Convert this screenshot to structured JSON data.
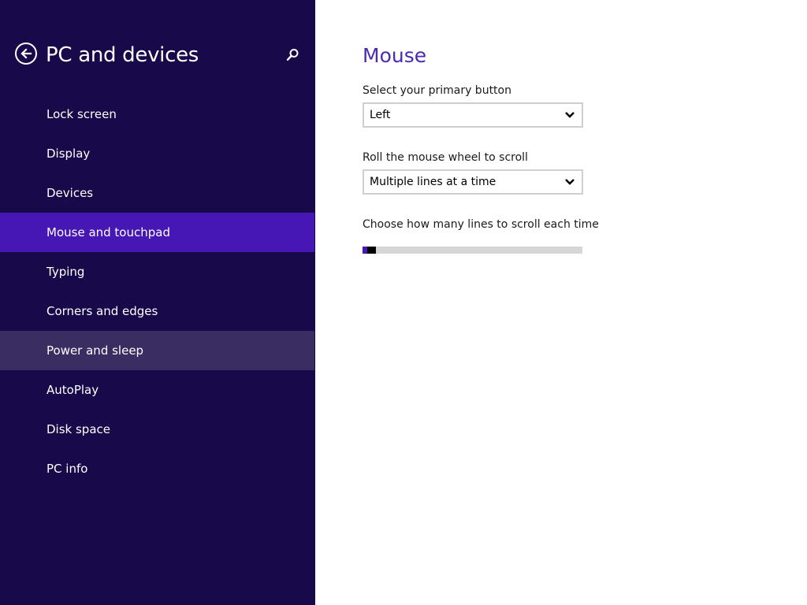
{
  "sidebar": {
    "title": "PC and devices",
    "back_icon": "back-arrow-icon",
    "search_icon": "search-icon",
    "items": [
      {
        "label": "Lock screen"
      },
      {
        "label": "Display"
      },
      {
        "label": "Devices"
      },
      {
        "label": "Mouse and touchpad"
      },
      {
        "label": "Typing"
      },
      {
        "label": "Corners and edges"
      },
      {
        "label": "Power and sleep"
      },
      {
        "label": "AutoPlay"
      },
      {
        "label": "Disk space"
      },
      {
        "label": "PC info"
      }
    ],
    "selected_item": "Mouse and touchpad",
    "hovered_item": "Power and sleep"
  },
  "main": {
    "title": "Mouse",
    "primary_button": {
      "label": "Select your primary button",
      "value": "Left"
    },
    "wheel_scroll": {
      "label": "Roll the mouse wheel to scroll",
      "value": "Multiple lines at a time"
    },
    "lines_to_scroll": {
      "label": "Choose how many lines to scroll each time",
      "value_fraction": 0.01
    }
  },
  "colors": {
    "sidebar_bg": "#180a4a",
    "selected_bg": "#4617b4",
    "hover_bg": "#3a2d62",
    "accent_title": "#4a2ab3"
  }
}
